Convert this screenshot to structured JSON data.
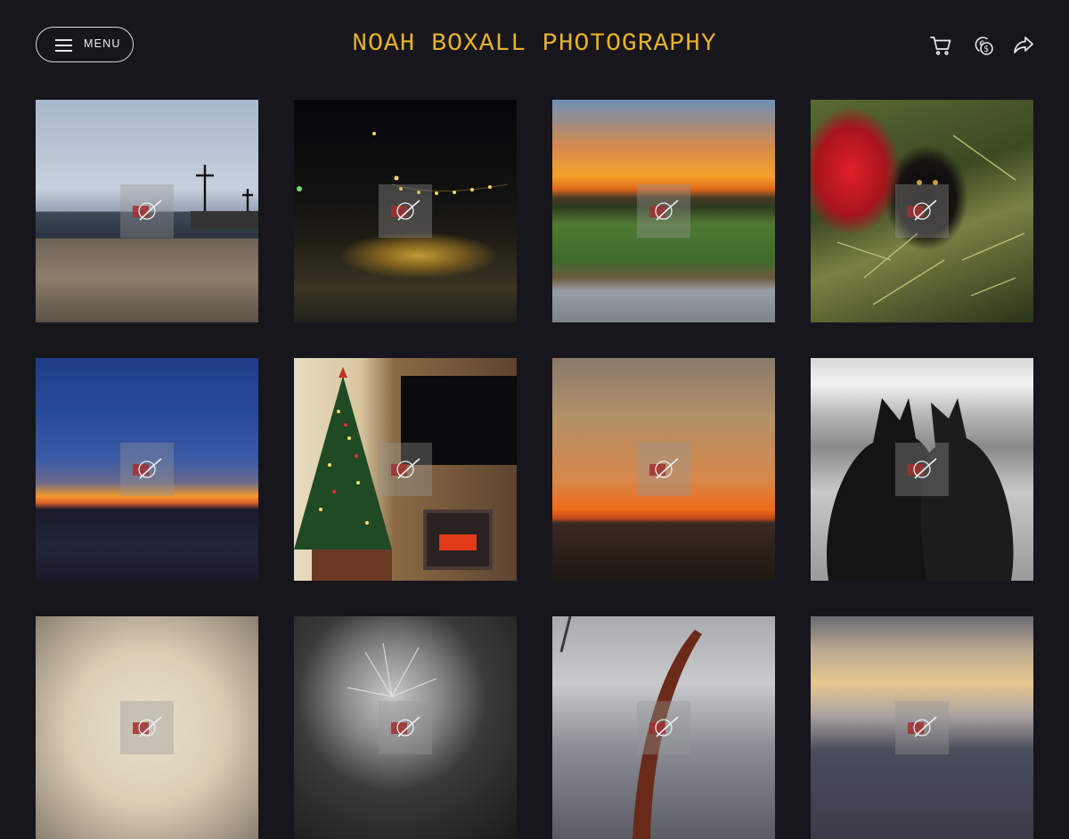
{
  "header": {
    "menu_label": "MENU",
    "site_title": "NOAH BOXALL PHOTOGRAPHY",
    "icons": [
      "cart-icon",
      "currency-icon",
      "share-icon"
    ]
  },
  "colors": {
    "background": "#17161d",
    "title": "#e6b328",
    "icon": "#e8e8e8"
  },
  "gallery": {
    "photos": [
      {
        "subject": "pier-lampposts"
      },
      {
        "subject": "night-string-lights"
      },
      {
        "subject": "sunset-field"
      },
      {
        "subject": "black-cat-tree"
      },
      {
        "subject": "blue-sunset-horizon"
      },
      {
        "subject": "christmas-tree-fireplace"
      },
      {
        "subject": "orange-sunset-field"
      },
      {
        "subject": "two-cats-window"
      },
      {
        "subject": "cream-vignette"
      },
      {
        "subject": "bw-flower"
      },
      {
        "subject": "sculpture-cloudy-sky"
      },
      {
        "subject": "golden-cloud-sky"
      }
    ]
  }
}
